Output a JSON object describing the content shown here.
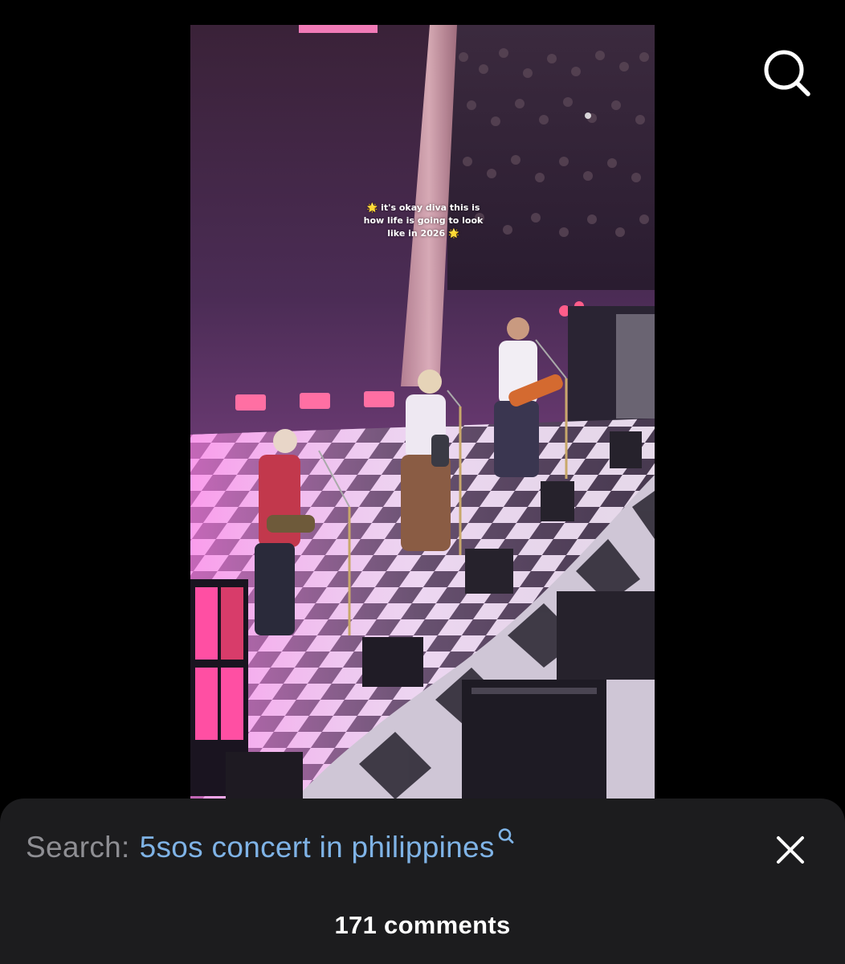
{
  "video": {
    "caption_line1": "it's okay diva this is",
    "caption_line2": "how life is going to look",
    "caption_line3": "like in 2026",
    "caption_emoji": "🌟"
  },
  "top_bar": {
    "search_icon": "search-icon"
  },
  "search_bar": {
    "prefix": "Search:",
    "query": "5sos concert in philippines",
    "query_icon": "search-icon",
    "close_icon": "close-icon"
  },
  "comments": {
    "count_label": "171 comments"
  },
  "colors": {
    "background": "#000000",
    "sheet": "#1c1c1e",
    "prefix_text": "#8e8e93",
    "query_text": "#7fb3e6",
    "white": "#ffffff"
  }
}
